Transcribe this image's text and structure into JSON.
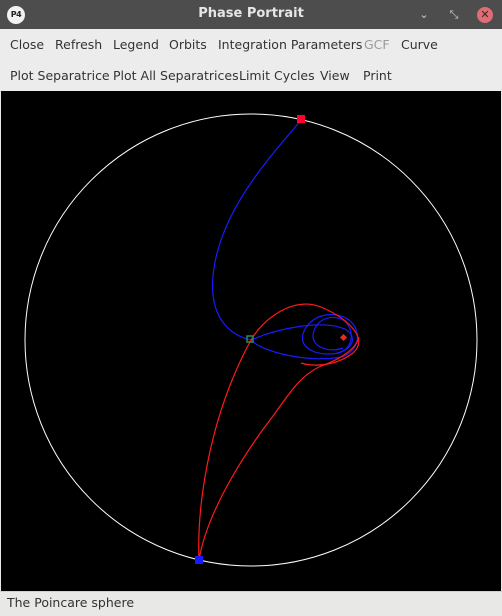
{
  "window": {
    "title": "Phase Portrait",
    "app_icon_text": "P4",
    "minimize_glyph": "⌄",
    "maximize_glyph": "⤡",
    "close_glyph": "✕"
  },
  "menu_row1": [
    "Close",
    "Refresh",
    "Legend",
    "Orbits",
    "Integration Parameters",
    "GCF",
    "Curve"
  ],
  "menu_row1_disabled": [
    "GCF"
  ],
  "menu_row2": [
    "Plot Separatrice",
    "Plot All Separatrices",
    "Limit Cycles",
    "View",
    "Print"
  ],
  "plot": {
    "background": "#000000",
    "sphere_color": "#ffffff",
    "stable_separatrix_color": "#1a1aff",
    "unstable_separatrix_color": "#ff1a1a",
    "critical_points": [
      {
        "type": "saddle",
        "color": "#2e8b57"
      },
      {
        "type": "unstable-focus",
        "color": "#ff2020"
      },
      {
        "type": "infinite-unstable-node",
        "color": "#ff0030"
      },
      {
        "type": "infinite-stable-node",
        "color": "#1a1aff"
      }
    ]
  },
  "status": {
    "text": "The Poincare sphere"
  }
}
